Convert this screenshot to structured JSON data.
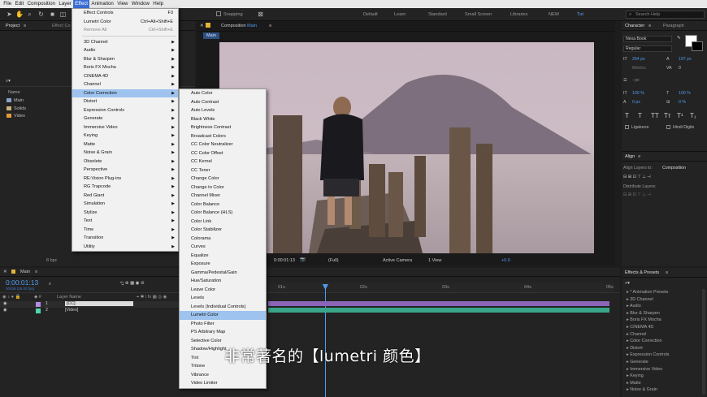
{
  "menubar": {
    "items": [
      "File",
      "Edit",
      "Composition",
      "Layer",
      "Effect",
      "Animation",
      "View",
      "Window",
      "Help"
    ],
    "active": "Effect"
  },
  "toolbar": {
    "snapping_label": "Snapping",
    "workspaces": [
      "Default",
      "Learn",
      "Standard",
      "Small Screen",
      "Libraries",
      "NEW",
      "Tut"
    ],
    "active_workspace": "Tut",
    "search_placeholder": "Search Help"
  },
  "project_panel": {
    "tab": "Project",
    "tab2": "Effect Co",
    "name_header": "Name",
    "items": [
      {
        "name": "Main",
        "icon": "composition-icon",
        "color": "#8aa2c8"
      },
      {
        "name": "Solids",
        "icon": "folder-icon",
        "color": "#c9b37a"
      },
      {
        "name": "Video",
        "icon": "video-file-icon",
        "color": "#e29a3a"
      }
    ],
    "bpc": "8 bpc"
  },
  "composition_panel": {
    "tab_prefix": "Composition",
    "tab_name": "Main",
    "subtab": "Main",
    "zoom_timecode": "0:00:01:13",
    "resolution": "(Full)",
    "camera": "Active Camera",
    "views": "1 View",
    "exposure": "+0.0"
  },
  "effect_menu": {
    "items": [
      {
        "label": "Effect Controls",
        "shortcut": "F3",
        "type": "item"
      },
      {
        "label": "Lumetri Color",
        "shortcut": "Ctrl+Alt+Shift+E",
        "type": "item"
      },
      {
        "label": "Remove All",
        "shortcut": "Ctrl+Shift+E",
        "type": "disabled"
      },
      {
        "type": "sep"
      },
      {
        "label": "3D Channel",
        "type": "sub"
      },
      {
        "label": "Audio",
        "type": "sub"
      },
      {
        "label": "Blur & Sharpen",
        "type": "sub"
      },
      {
        "label": "Boris FX Mocha",
        "type": "sub"
      },
      {
        "label": "CINEMA 4D",
        "type": "sub"
      },
      {
        "label": "Channel",
        "type": "sub"
      },
      {
        "label": "Color Correction",
        "type": "sub",
        "highlighted": true
      },
      {
        "label": "Distort",
        "type": "sub"
      },
      {
        "label": "Expression Controls",
        "type": "sub"
      },
      {
        "label": "Generate",
        "type": "sub"
      },
      {
        "label": "Immersive Video",
        "type": "sub"
      },
      {
        "label": "Keying",
        "type": "sub"
      },
      {
        "label": "Matte",
        "type": "sub"
      },
      {
        "label": "Noise & Grain",
        "type": "sub"
      },
      {
        "label": "Obsolete",
        "type": "sub"
      },
      {
        "label": "Perspective",
        "type": "sub"
      },
      {
        "label": "RE:Vision Plug-ins",
        "type": "sub"
      },
      {
        "label": "RG Trapcode",
        "type": "sub"
      },
      {
        "label": "Red Giant",
        "type": "sub"
      },
      {
        "label": "Simulation",
        "type": "sub"
      },
      {
        "label": "Stylize",
        "type": "sub"
      },
      {
        "label": "Text",
        "type": "sub"
      },
      {
        "label": "Time",
        "type": "sub"
      },
      {
        "label": "Transition",
        "type": "sub"
      },
      {
        "label": "Utility",
        "type": "sub"
      }
    ]
  },
  "color_correction_menu": {
    "items": [
      "Auto Color",
      "Auto Contrast",
      "Auto Levels",
      "Black  White",
      "Brightness  Contrast",
      "Broadcast Colors",
      "CC Color Neutralizer",
      "CC Color Offset",
      "CC Kernel",
      "CC Toner",
      "Change Color",
      "Change to Color",
      "Channel Mixer",
      "Color Balance",
      "Color Balance (HLS)",
      "Color Link",
      "Color Stabilizer",
      "Colorama",
      "Curves",
      "Equalize",
      "Exposure",
      "Gamma/Pedestal/Gain",
      "Hue/Saturation",
      "Leave Color",
      "Levels",
      "Levels (Individual Controls)",
      "Lumetri Color",
      "Photo Filter",
      "PS Arbitrary Map",
      "Selective Color",
      "Shadow/Highlight",
      "Tint",
      "Tritone",
      "Vibrance",
      "Video Limiter"
    ],
    "highlighted": "Lumetri Color"
  },
  "character_panel": {
    "tab": "Character",
    "tab2": "Paragraph",
    "font": "Nexa Book",
    "style": "Regular",
    "size": "264 px",
    "leading": "197 px",
    "tracking_label": "Metrics",
    "tracking": "0",
    "stroke": "- px",
    "vscale": "100 %",
    "hscale": "100 %",
    "baseline": "0 px",
    "tsume": "0 %",
    "style_buttons": [
      "T",
      "T",
      "TT",
      "Tт",
      "T¹",
      "T₁"
    ],
    "ligatures": "Ligatures",
    "hindi": "Hindi Digits",
    "fill_color": "#ffffff",
    "stroke_color": "#000000"
  },
  "align_panel": {
    "tab": "Align",
    "align_to_label": "Align Layers to:",
    "align_to_value": "Composition",
    "distribute_label": "Distribute Layers:"
  },
  "timeline": {
    "tab": "Main",
    "timecode": "0:00:01:13",
    "frames": "00038 (25.00 fps)",
    "layer_name_header": "Layer Name",
    "layers": [
      {
        "num": "1",
        "name": "[CC]",
        "color": "#b48ce6"
      },
      {
        "num": "2",
        "name": "[Video]",
        "color": "#4ed6b0"
      }
    ],
    "ruler": [
      "01s",
      "02s",
      "03s",
      "04s",
      "05s"
    ],
    "playhead_fraction": 0.3
  },
  "effects_presets": {
    "tab": "Effects & Presets",
    "items": [
      "* Animation Presets",
      "3D Channel",
      "Audio",
      "Blur & Sharpen",
      "Boris FX Mocha",
      "CINEMA 4D",
      "Channel",
      "Color Correction",
      "Distort",
      "Expression Controls",
      "Generate",
      "Immersive Video",
      "Keying",
      "Matte",
      "Noise & Grain"
    ]
  },
  "subtitle": "非常著名的【lumetri 颜色】"
}
